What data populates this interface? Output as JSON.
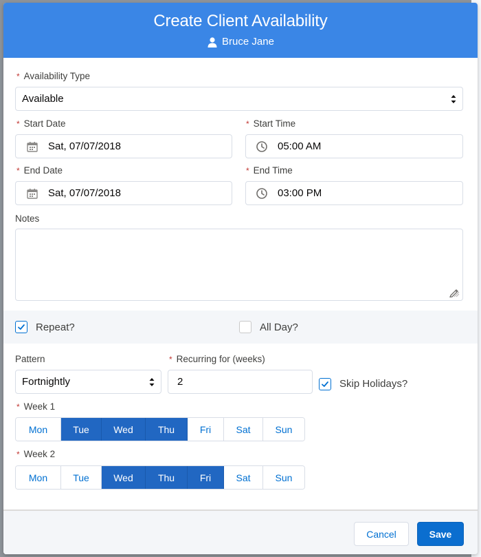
{
  "header": {
    "title": "Create Client Availability",
    "client_name": "Bruce Jane"
  },
  "form": {
    "availability_type": {
      "label": "Availability Type",
      "value": "Available"
    },
    "start_date": {
      "label": "Start Date",
      "value": "Sat, 07/07/2018"
    },
    "start_time": {
      "label": "Start Time",
      "value": "05:00 AM"
    },
    "end_date": {
      "label": "End Date",
      "value": "Sat, 07/07/2018"
    },
    "end_time": {
      "label": "End Time",
      "value": "03:00 PM"
    },
    "notes": {
      "label": "Notes",
      "value": ""
    },
    "repeat": {
      "label": "Repeat?",
      "checked": true
    },
    "all_day": {
      "label": "All Day?",
      "checked": false
    },
    "pattern": {
      "label": "Pattern",
      "value": "Fortnightly"
    },
    "recurring": {
      "label": "Recurring for (weeks)",
      "value": "2"
    },
    "skip_holidays": {
      "label": "Skip Holidays?",
      "checked": true
    },
    "week1": {
      "label": "Week 1",
      "days": [
        {
          "label": "Mon",
          "selected": false
        },
        {
          "label": "Tue",
          "selected": true
        },
        {
          "label": "Wed",
          "selected": true
        },
        {
          "label": "Thu",
          "selected": true
        },
        {
          "label": "Fri",
          "selected": false
        },
        {
          "label": "Sat",
          "selected": false
        },
        {
          "label": "Sun",
          "selected": false
        }
      ]
    },
    "week2": {
      "label": "Week 2",
      "days": [
        {
          "label": "Mon",
          "selected": false
        },
        {
          "label": "Tue",
          "selected": false
        },
        {
          "label": "Wed",
          "selected": true
        },
        {
          "label": "Thu",
          "selected": true
        },
        {
          "label": "Fri",
          "selected": true
        },
        {
          "label": "Sat",
          "selected": false
        },
        {
          "label": "Sun",
          "selected": false
        }
      ]
    }
  },
  "footer": {
    "cancel_label": "Cancel",
    "save_label": "Save"
  },
  "icons": {
    "client": "user-icon",
    "date": "calendar-icon",
    "time": "clock-icon",
    "check": "check-icon",
    "select": "select-arrows-icon",
    "resize": "resize-handle-icon"
  },
  "colors": {
    "header": "#3a86e6",
    "accent": "#0070d2",
    "selected_day": "#2167c2",
    "required": "#c23934"
  }
}
